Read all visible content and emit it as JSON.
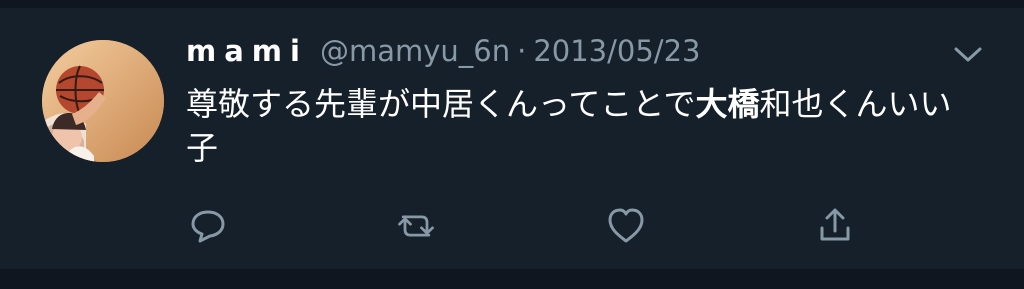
{
  "tweet": {
    "display_name": "mami",
    "handle": "@mamyu_6n",
    "separator": "·",
    "date": "2013/05/23",
    "text_before": "尊敬する先輩が中居くんってことで",
    "text_highlight": "大橋",
    "text_after": "和也くんいい子",
    "avatar_icon": "basketball-player-avatar",
    "menu_icon": "chevron-down-icon"
  },
  "actions": [
    {
      "name": "reply",
      "icon": "reply-icon"
    },
    {
      "name": "retweet",
      "icon": "retweet-icon"
    },
    {
      "name": "like",
      "icon": "heart-icon"
    },
    {
      "name": "share",
      "icon": "share-icon"
    }
  ],
  "colors": {
    "background": "#15202b",
    "divider": "#10161f",
    "primary_text": "#ffffff",
    "secondary_text": "#8899a6"
  }
}
